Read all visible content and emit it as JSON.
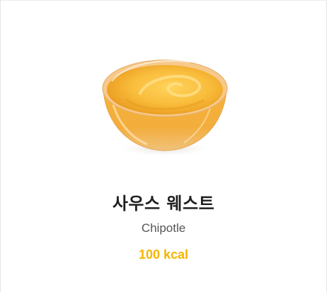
{
  "product": {
    "name": "사우스 웨스트",
    "subtitle": "Chipotle",
    "calories": "100 kcal",
    "image_icon": "sauce-bowl-icon"
  },
  "colors": {
    "calorie_accent": "#f5b400",
    "sauce": "#f5ab2e"
  }
}
